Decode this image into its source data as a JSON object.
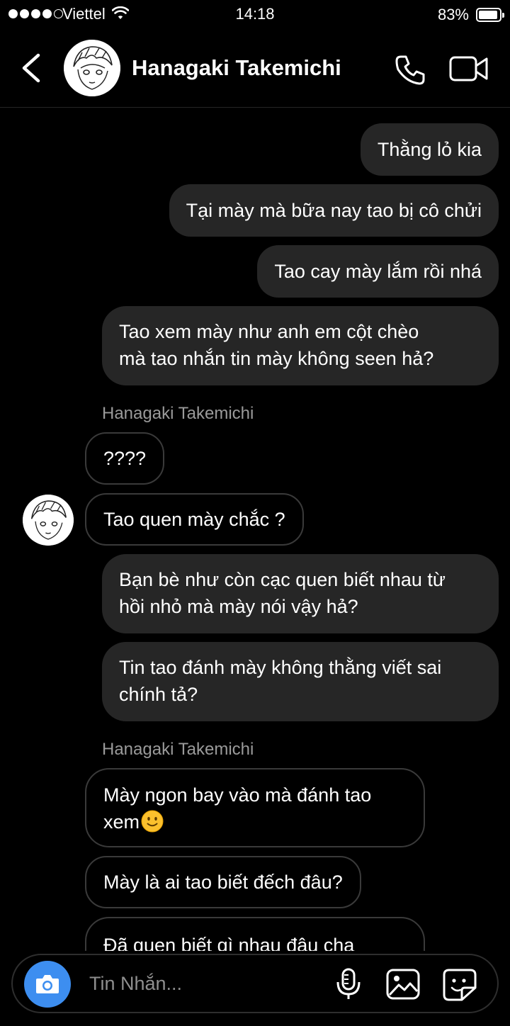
{
  "status_bar": {
    "carrier": "Viettel",
    "time": "14:18",
    "battery": "83%"
  },
  "header": {
    "contact_name": "Hanagaki Takemichi",
    "avatar": "contact-avatar"
  },
  "messages": [
    {
      "direction": "out",
      "text": "Thằng lỏ kia"
    },
    {
      "direction": "out",
      "text": "Tại mày mà bữa nay tao bị cô chửi"
    },
    {
      "direction": "out",
      "text": "Tao cay mày lắm rồi nhá"
    },
    {
      "direction": "out",
      "text": "Tao xem mày như anh em cột chèo mà tao nhắn tin mày không seen hả?",
      "lines": [
        "Tao xem mày như anh em cột chèo",
        "mà tao nhắn tin mày không seen hả?"
      ]
    },
    {
      "direction": "in",
      "sender": "Hanagaki Takemichi"
    },
    {
      "direction": "in",
      "text": "????"
    },
    {
      "direction": "in",
      "text": "Tao quen mày chắc ?"
    },
    {
      "direction": "out",
      "text": "Bạn bè như còn cạc quen biết nhau từ hồi nhỏ mà mày nói vậy hả?",
      "lines": [
        "Bạn bè như còn cạc quen biết nhau từ",
        "hồi nhỏ mà mày nói vậy hả?"
      ]
    },
    {
      "direction": "out",
      "text": "Tin tao đánh mày không thằng viết sai chính tả?",
      "lines": [
        "Tin tao đánh mày không thằng viết sai",
        "chính tả?"
      ]
    },
    {
      "direction": "in",
      "sender": "Hanagaki Takemichi"
    },
    {
      "direction": "in",
      "text": "Mày ngon bay vào mà đánh tao xem",
      "lines": [
        "Mày ngon bay vào mà đánh tao",
        "xem"
      ],
      "emoji": "slightly-smiling-face"
    },
    {
      "direction": "in",
      "text": "Mày là ai tao biết đếch đâu?"
    },
    {
      "direction": "in",
      "text": "Đã quen biết gì nhau đâu cha"
    }
  ],
  "composer": {
    "placeholder": "Tin Nhắn...",
    "icons": [
      "camera-icon",
      "microphone-icon",
      "gallery-icon",
      "sticker-icon"
    ],
    "camera_color": "#3d8ef0"
  },
  "colors": {
    "background": "#000000",
    "outgoing_bubble": "#262626",
    "incoming_border": "#3a3a3a",
    "sender_text": "#9a9a9a"
  }
}
